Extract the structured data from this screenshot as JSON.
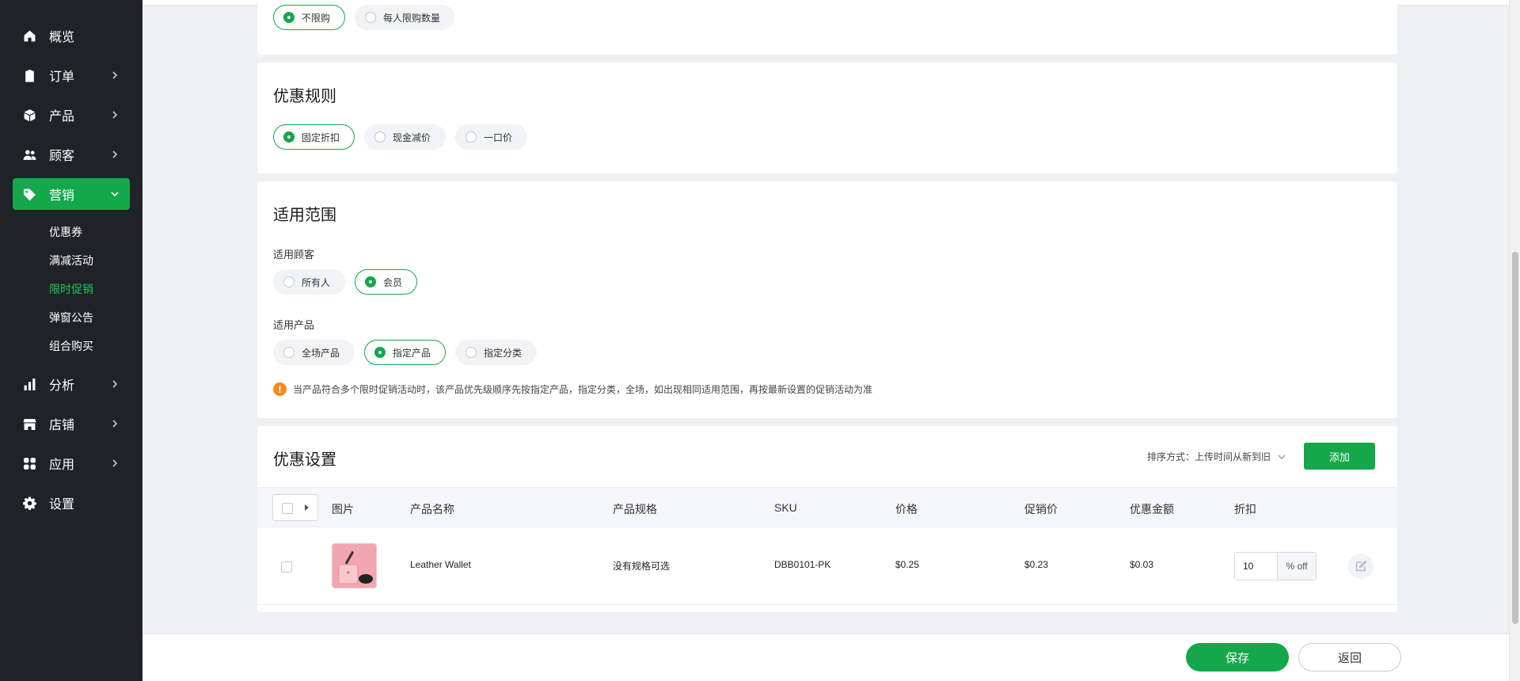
{
  "sidebar": {
    "items": [
      {
        "label": "概览",
        "icon": "home-icon"
      },
      {
        "label": "订单",
        "icon": "clipboard-icon"
      },
      {
        "label": "产品",
        "icon": "box-icon"
      },
      {
        "label": "顾客",
        "icon": "users-icon"
      },
      {
        "label": "营销",
        "icon": "tag-icon",
        "active": true
      },
      {
        "label": "分析",
        "icon": "bar-chart-icon"
      },
      {
        "label": "店铺",
        "icon": "store-icon"
      },
      {
        "label": "应用",
        "icon": "apps-icon"
      },
      {
        "label": "设置",
        "icon": "gear-icon"
      }
    ],
    "subitems": [
      "优惠券",
      "满减活动",
      "限时促销",
      "弹窗公告",
      "组合购买"
    ],
    "current_subitem": "限时促销"
  },
  "purchase_limit": {
    "options": [
      "不限购",
      "每人限购数量"
    ],
    "selected": "不限购"
  },
  "discount_rules": {
    "title": "优惠规则",
    "options": [
      "固定折扣",
      "现金减价",
      "一口价"
    ],
    "selected": "固定折扣"
  },
  "scope": {
    "title": "适用范围",
    "customer_label": "适用顾客",
    "customer_options": [
      "所有人",
      "会员"
    ],
    "customer_selected": "会员",
    "product_label": "适用产品",
    "product_options": [
      "全场产品",
      "指定产品",
      "指定分类"
    ],
    "product_selected": "指定产品",
    "notice": "当产品符合多个限时促销活动时，该产品优先级顺序先按指定产品，指定分类，全场，如出现相同适用范围，再按最新设置的促销活动为准"
  },
  "discount_settings": {
    "title": "优惠设置",
    "sort_label": "排序方式：上传时间从新到旧",
    "add_label": "添加",
    "columns": [
      "图片",
      "产品名称",
      "产品规格",
      "SKU",
      "价格",
      "促销价",
      "优惠金额",
      "折扣"
    ],
    "rows": [
      {
        "name": "Leather Wallet",
        "spec": "没有规格可选",
        "sku": "DBB0101-PK",
        "price": "$0.25",
        "promo_price": "$0.23",
        "discount_amount": "$0.03",
        "discount": "10",
        "discount_unit": "% off"
      }
    ]
  },
  "footer": {
    "save_label": "保存",
    "back_label": "返回"
  },
  "colors": {
    "accent": "#14a84a",
    "sidebar_bg": "#1f2328",
    "warning": "#f08a24"
  }
}
